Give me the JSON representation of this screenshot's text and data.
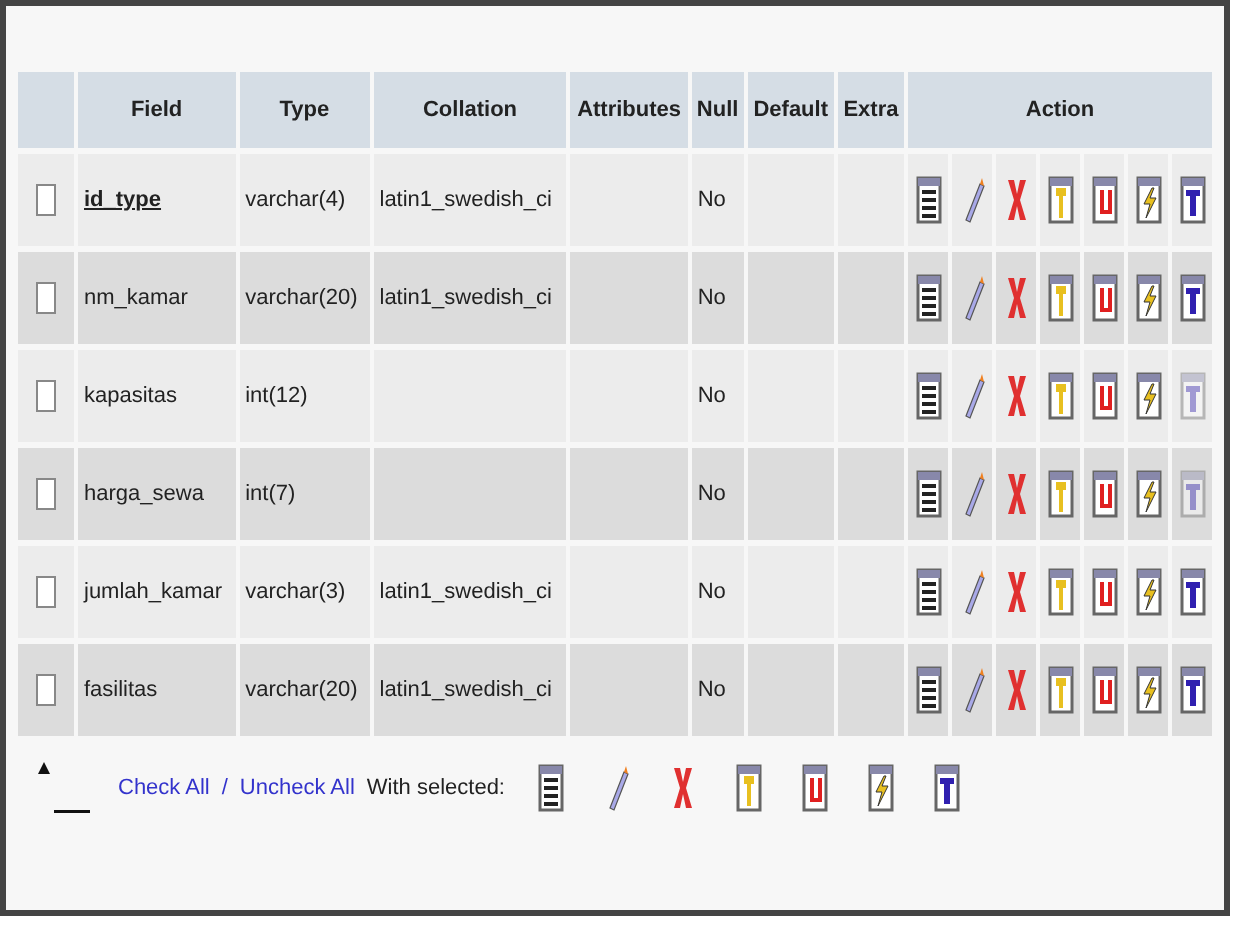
{
  "columns": [
    "Field",
    "Type",
    "Collation",
    "Attributes",
    "Null",
    "Default",
    "Extra",
    "Action"
  ],
  "rows": [
    {
      "field": "id_type",
      "primary": true,
      "type": "varchar(4)",
      "collation": "latin1_swedish_ci",
      "null": "No",
      "checked": false,
      "fulltext_enabled": true
    },
    {
      "field": "nm_kamar",
      "primary": false,
      "type": "varchar(20)",
      "collation": "latin1_swedish_ci",
      "null": "No",
      "checked": false,
      "fulltext_enabled": true
    },
    {
      "field": "kapasitas",
      "primary": false,
      "type": "int(12)",
      "null": "No",
      "checked": false,
      "fulltext_enabled": false
    },
    {
      "field": "harga_sewa",
      "primary": false,
      "type": "int(7)",
      "null": "No",
      "checked": false,
      "fulltext_enabled": false
    },
    {
      "field": "jumlah_kamar",
      "primary": false,
      "type": "varchar(3)",
      "collation": "latin1_swedish_ci",
      "null": "No",
      "checked": false,
      "fulltext_enabled": true
    },
    {
      "field": "fasilitas",
      "primary": false,
      "type": "varchar(20)",
      "collation": "latin1_swedish_ci",
      "null": "No",
      "checked": false,
      "fulltext_enabled": true
    }
  ],
  "footer": {
    "check_all": "Check All",
    "separator": "/",
    "uncheck_all": "Uncheck All",
    "with_selected": "With selected:"
  }
}
